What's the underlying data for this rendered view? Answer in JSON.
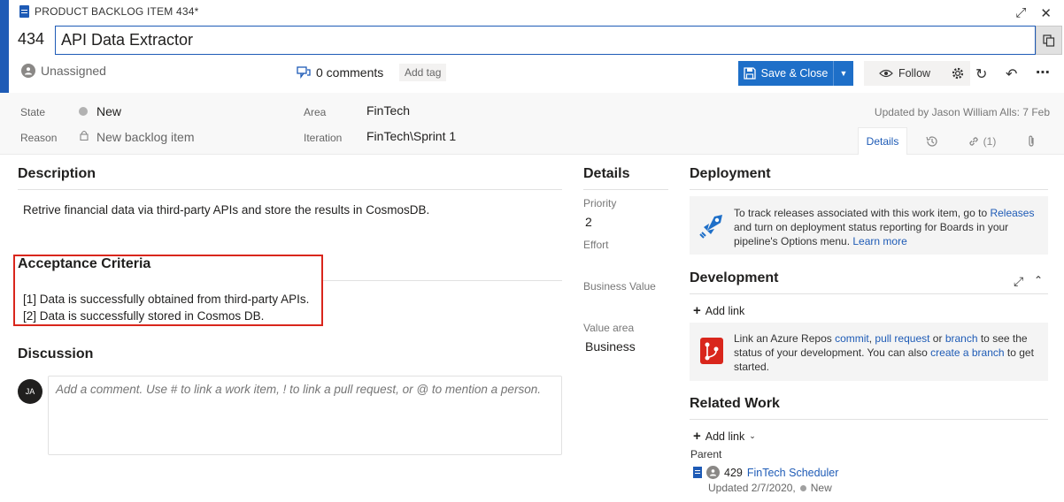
{
  "header": {
    "type_label": "PRODUCT BACKLOG ITEM 434*",
    "id": "434",
    "title": "API Data Extractor",
    "assigned": "Unassigned",
    "comments": "0 comments",
    "add_tag": "Add tag",
    "save_close": "Save & Close",
    "follow": "Follow"
  },
  "fields": {
    "state_label": "State",
    "state_value": "New",
    "reason_label": "Reason",
    "reason_value": "New backlog item",
    "area_label": "Area",
    "area_value": "FinTech",
    "iteration_label": "Iteration",
    "iteration_value": "FinTech\\Sprint 1",
    "updated": "Updated by Jason William Alls: 7 Feb"
  },
  "tabs": {
    "details": "Details",
    "links_count": "(1)"
  },
  "description": {
    "title": "Description",
    "text": "Retrive financial data via third-party APIs and store the results in CosmosDB."
  },
  "acceptance": {
    "title": "Acceptance Criteria",
    "items": [
      "[1] Data is successfully obtained from third-party APIs.",
      "[2] Data is successfully stored in Cosmos DB."
    ]
  },
  "discussion": {
    "title": "Discussion",
    "avatar": "JA",
    "placeholder": "Add a comment. Use # to link a work item, ! to link a pull request, or @ to mention a person."
  },
  "details": {
    "title": "Details",
    "priority_label": "Priority",
    "priority_value": "2",
    "effort_label": "Effort",
    "business_value_label": "Business Value",
    "value_area_label": "Value area",
    "value_area_value": "Business"
  },
  "deployment": {
    "title": "Deployment",
    "text_a": "To track releases associated with this work item, go to ",
    "link_releases": "Releases",
    "text_b": " and turn on deployment status reporting for Boards in your pipeline's Options menu. ",
    "link_learn": "Learn more"
  },
  "development": {
    "title": "Development",
    "add_link": "Add link",
    "text_a": "Link an Azure Repos ",
    "link_commit": "commit",
    "sep1": ", ",
    "link_pr": "pull request",
    "text_or": " or ",
    "link_branch": "branch",
    "text_b": " to see the status of your development. You can also ",
    "link_create": "create a branch",
    "text_c": " to get started."
  },
  "related": {
    "title": "Related Work",
    "add_link": "Add link",
    "parent_label": "Parent",
    "parent_id": "429",
    "parent_title": "FinTech Scheduler",
    "parent_updated": "Updated 2/7/2020,",
    "parent_state": "New"
  },
  "colors": {
    "accent": "#1e5bb6",
    "save_button": "#1e6fc8",
    "highlight_border": "#d9261c"
  }
}
